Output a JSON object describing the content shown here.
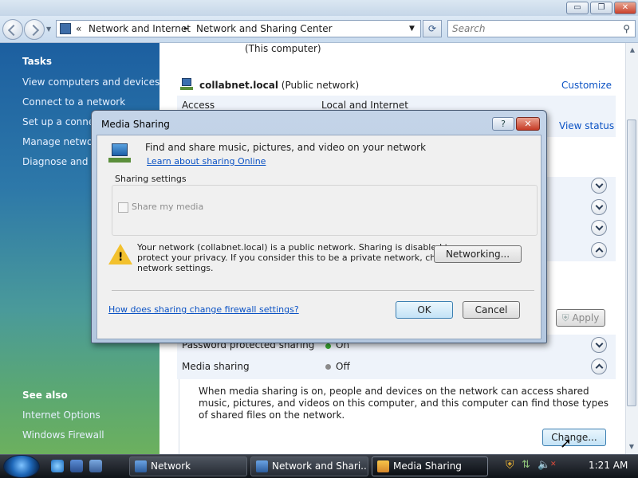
{
  "window": {
    "minimize": "▭",
    "restore": "❐",
    "close": "✕"
  },
  "address": {
    "chevrons": "«",
    "crumb1": "Network and Internet",
    "sep": "►",
    "crumb2": "Network and Sharing Center",
    "dropdown": "▼",
    "refresh": "⟳"
  },
  "search": {
    "placeholder": "Search",
    "icon": "search-icon"
  },
  "sidebar": {
    "tasks_heading": "Tasks",
    "tasks": [
      "View computers and devices",
      "Connect to a network",
      "Set up a connect",
      "Manage networ",
      "Diagnose and re"
    ],
    "see_also_heading": "See also",
    "see_also": [
      "Internet Options",
      "Windows Firewall"
    ]
  },
  "main": {
    "this_computer": "(This computer)",
    "network_name": "collabnet.local",
    "network_type": "(Public network)",
    "customize": "Customize",
    "access_label": "Access",
    "access_value": "Local and Internet",
    "view_status": "View status",
    "apply": "Apply",
    "password_label": "Password protected sharing",
    "password_value": "On",
    "media_label": "Media sharing",
    "media_value": "Off",
    "media_desc": "When media sharing is on, people and devices on the network can access shared music, pictures, and videos on this computer, and this computer can find those types of shared files on the network.",
    "change": "Change...",
    "status_on_color": "#3aa832",
    "status_off_color": "#8a8a8a"
  },
  "dialog": {
    "title": "Media Sharing",
    "help": "?",
    "close": "✕",
    "intro": "Find and share music, pictures, and video on your network",
    "learn_link": "Learn about sharing Online",
    "group_title": "Sharing settings",
    "share_my_media": "Share my media",
    "warning_line1": "Your network (collabnet.local) is a public network. Sharing is disabled to",
    "warning_line2": "protect your privacy. If you consider this to be a private network, change",
    "warning_line3": "network settings.",
    "networking_button": "Networking...",
    "firewall_link": "How does sharing change firewall settings?",
    "ok": "OK",
    "cancel": "Cancel"
  },
  "taskbar": {
    "buttons": [
      "Network",
      "Network and Shari...",
      "Media Sharing"
    ],
    "clock": "1:21 AM"
  },
  "colors": {
    "link": "#0b52c4",
    "accent": "#1c5fa0"
  }
}
